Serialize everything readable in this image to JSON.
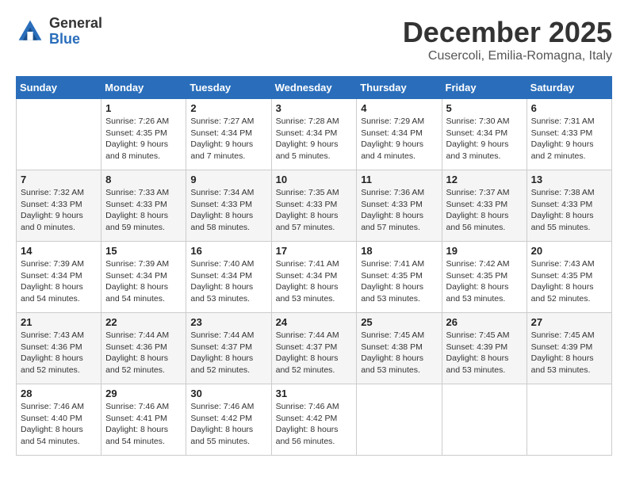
{
  "header": {
    "logo_line1": "General",
    "logo_line2": "Blue",
    "month_title": "December 2025",
    "subtitle": "Cusercoli, Emilia-Romagna, Italy"
  },
  "weekdays": [
    "Sunday",
    "Monday",
    "Tuesday",
    "Wednesday",
    "Thursday",
    "Friday",
    "Saturday"
  ],
  "weeks": [
    [
      {
        "day": "",
        "info": ""
      },
      {
        "day": "1",
        "info": "Sunrise: 7:26 AM\nSunset: 4:35 PM\nDaylight: 9 hours\nand 8 minutes."
      },
      {
        "day": "2",
        "info": "Sunrise: 7:27 AM\nSunset: 4:34 PM\nDaylight: 9 hours\nand 7 minutes."
      },
      {
        "day": "3",
        "info": "Sunrise: 7:28 AM\nSunset: 4:34 PM\nDaylight: 9 hours\nand 5 minutes."
      },
      {
        "day": "4",
        "info": "Sunrise: 7:29 AM\nSunset: 4:34 PM\nDaylight: 9 hours\nand 4 minutes."
      },
      {
        "day": "5",
        "info": "Sunrise: 7:30 AM\nSunset: 4:34 PM\nDaylight: 9 hours\nand 3 minutes."
      },
      {
        "day": "6",
        "info": "Sunrise: 7:31 AM\nSunset: 4:33 PM\nDaylight: 9 hours\nand 2 minutes."
      }
    ],
    [
      {
        "day": "7",
        "info": "Sunrise: 7:32 AM\nSunset: 4:33 PM\nDaylight: 9 hours\nand 0 minutes."
      },
      {
        "day": "8",
        "info": "Sunrise: 7:33 AM\nSunset: 4:33 PM\nDaylight: 8 hours\nand 59 minutes."
      },
      {
        "day": "9",
        "info": "Sunrise: 7:34 AM\nSunset: 4:33 PM\nDaylight: 8 hours\nand 58 minutes."
      },
      {
        "day": "10",
        "info": "Sunrise: 7:35 AM\nSunset: 4:33 PM\nDaylight: 8 hours\nand 57 minutes."
      },
      {
        "day": "11",
        "info": "Sunrise: 7:36 AM\nSunset: 4:33 PM\nDaylight: 8 hours\nand 57 minutes."
      },
      {
        "day": "12",
        "info": "Sunrise: 7:37 AM\nSunset: 4:33 PM\nDaylight: 8 hours\nand 56 minutes."
      },
      {
        "day": "13",
        "info": "Sunrise: 7:38 AM\nSunset: 4:33 PM\nDaylight: 8 hours\nand 55 minutes."
      }
    ],
    [
      {
        "day": "14",
        "info": "Sunrise: 7:39 AM\nSunset: 4:34 PM\nDaylight: 8 hours\nand 54 minutes."
      },
      {
        "day": "15",
        "info": "Sunrise: 7:39 AM\nSunset: 4:34 PM\nDaylight: 8 hours\nand 54 minutes."
      },
      {
        "day": "16",
        "info": "Sunrise: 7:40 AM\nSunset: 4:34 PM\nDaylight: 8 hours\nand 53 minutes."
      },
      {
        "day": "17",
        "info": "Sunrise: 7:41 AM\nSunset: 4:34 PM\nDaylight: 8 hours\nand 53 minutes."
      },
      {
        "day": "18",
        "info": "Sunrise: 7:41 AM\nSunset: 4:35 PM\nDaylight: 8 hours\nand 53 minutes."
      },
      {
        "day": "19",
        "info": "Sunrise: 7:42 AM\nSunset: 4:35 PM\nDaylight: 8 hours\nand 53 minutes."
      },
      {
        "day": "20",
        "info": "Sunrise: 7:43 AM\nSunset: 4:35 PM\nDaylight: 8 hours\nand 52 minutes."
      }
    ],
    [
      {
        "day": "21",
        "info": "Sunrise: 7:43 AM\nSunset: 4:36 PM\nDaylight: 8 hours\nand 52 minutes."
      },
      {
        "day": "22",
        "info": "Sunrise: 7:44 AM\nSunset: 4:36 PM\nDaylight: 8 hours\nand 52 minutes."
      },
      {
        "day": "23",
        "info": "Sunrise: 7:44 AM\nSunset: 4:37 PM\nDaylight: 8 hours\nand 52 minutes."
      },
      {
        "day": "24",
        "info": "Sunrise: 7:44 AM\nSunset: 4:37 PM\nDaylight: 8 hours\nand 52 minutes."
      },
      {
        "day": "25",
        "info": "Sunrise: 7:45 AM\nSunset: 4:38 PM\nDaylight: 8 hours\nand 53 minutes."
      },
      {
        "day": "26",
        "info": "Sunrise: 7:45 AM\nSunset: 4:39 PM\nDaylight: 8 hours\nand 53 minutes."
      },
      {
        "day": "27",
        "info": "Sunrise: 7:45 AM\nSunset: 4:39 PM\nDaylight: 8 hours\nand 53 minutes."
      }
    ],
    [
      {
        "day": "28",
        "info": "Sunrise: 7:46 AM\nSunset: 4:40 PM\nDaylight: 8 hours\nand 54 minutes."
      },
      {
        "day": "29",
        "info": "Sunrise: 7:46 AM\nSunset: 4:41 PM\nDaylight: 8 hours\nand 54 minutes."
      },
      {
        "day": "30",
        "info": "Sunrise: 7:46 AM\nSunset: 4:42 PM\nDaylight: 8 hours\nand 55 minutes."
      },
      {
        "day": "31",
        "info": "Sunrise: 7:46 AM\nSunset: 4:42 PM\nDaylight: 8 hours\nand 56 minutes."
      },
      {
        "day": "",
        "info": ""
      },
      {
        "day": "",
        "info": ""
      },
      {
        "day": "",
        "info": ""
      }
    ]
  ]
}
